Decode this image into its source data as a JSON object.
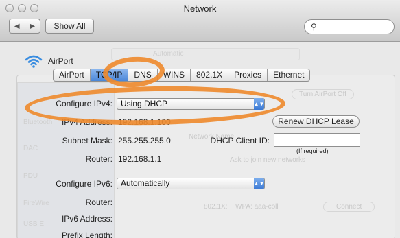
{
  "window": {
    "title": "Network"
  },
  "toolbar": {
    "back_glyph": "◀",
    "forward_glyph": "▶",
    "show_all_label": "Show All",
    "search_placeholder": "",
    "search_glyph": "⚲"
  },
  "interface": {
    "name": "AirPort",
    "icon": "wifi-icon"
  },
  "background": {
    "location_label": "Automatic",
    "items": [
      "Bluetooth",
      "DAC",
      "PDU",
      "FireWire",
      "USB E"
    ],
    "texts": [
      "Turn AirPort Off",
      "Network Name",
      "Ask to join new networks",
      "802.1X:",
      "WPA: aaa-coll",
      "Connect"
    ]
  },
  "tabs": [
    {
      "label": "AirPort",
      "active": false
    },
    {
      "label": "TCP/IP",
      "active": true
    },
    {
      "label": "DNS",
      "active": false
    },
    {
      "label": "WINS",
      "active": false
    },
    {
      "label": "802.1X",
      "active": false
    },
    {
      "label": "Proxies",
      "active": false
    },
    {
      "label": "Ethernet",
      "active": false
    }
  ],
  "tcpip": {
    "configure_ipv4_label": "Configure IPv4:",
    "configure_ipv4_value": "Using DHCP",
    "ipv4_address_label": "IPv4 Address:",
    "ipv4_address_value": "192.168.1.100",
    "subnet_mask_label": "Subnet Mask:",
    "subnet_mask_value": "255.255.255.0",
    "router_label": "Router:",
    "router_value": "192.168.1.1",
    "renew_button": "Renew DHCP Lease",
    "dhcp_client_id_label": "DHCP Client ID:",
    "dhcp_client_id_value": "",
    "dhcp_hint": "(If required)",
    "configure_ipv6_label": "Configure IPv6:",
    "configure_ipv6_value": "Automatically",
    "router6_label": "Router:",
    "ipv6_address_label": "IPv6 Address:",
    "prefix_length_label": "Prefix Length:",
    "popup_arrow_glyph": "▲▼"
  },
  "colors": {
    "annotation": "#ee8a2c",
    "active_tab": "#4a86d8"
  }
}
